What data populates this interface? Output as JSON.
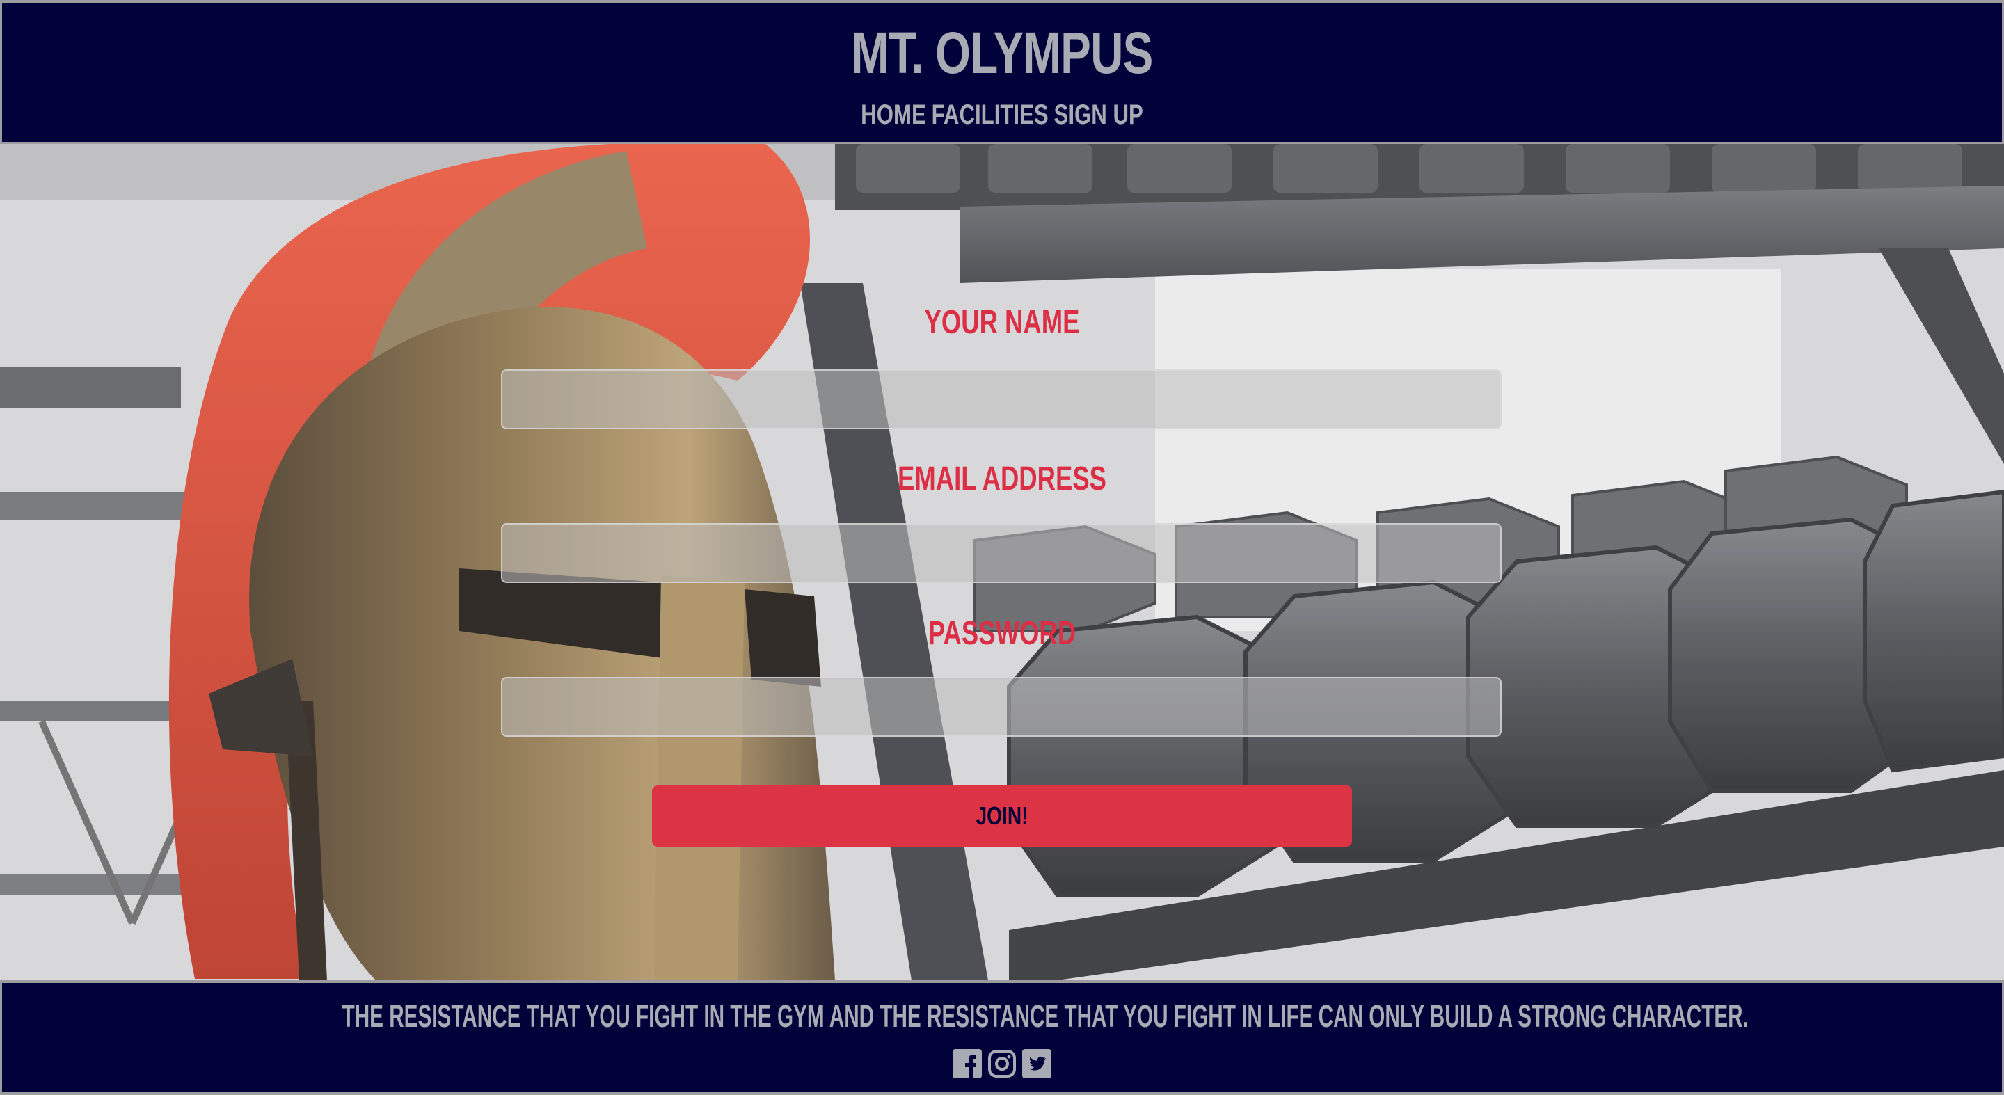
{
  "header": {
    "title": "MT. OLYMPUS",
    "nav": [
      {
        "label": "HOME"
      },
      {
        "label": "FACILITIES"
      },
      {
        "label": "SIGN UP"
      }
    ]
  },
  "form": {
    "name_label": "YOUR NAME",
    "email_label": "EMAIL ADDRESS",
    "password_label": "PASSWORD",
    "submit_label": "JOIN!"
  },
  "footer": {
    "quote": "THE RESISTANCE THAT YOU FIGHT IN THE GYM AND THE RESISTANCE THAT YOU FIGHT IN LIFE CAN ONLY BUILD A STRONG CHARACTER.",
    "socials": [
      {
        "icon": "facebook-icon"
      },
      {
        "icon": "instagram-icon"
      },
      {
        "icon": "twitter-icon"
      }
    ]
  },
  "hero": {
    "image": "spartan-helmet-and-dumbbell-rack"
  },
  "colors": {
    "header_bg": "#02023b",
    "header_text": "#a9abb4",
    "label_red": "#dc2f46",
    "button_red": "#dc3445",
    "button_text": "#02023b"
  }
}
